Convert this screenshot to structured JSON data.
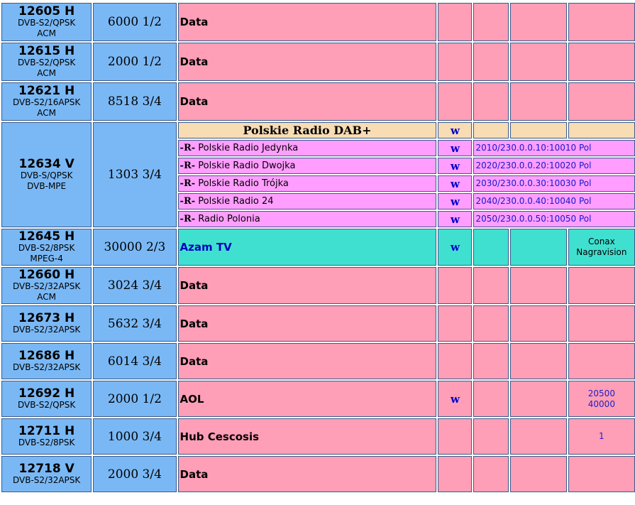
{
  "transponders": [
    {
      "freq": "12605 H",
      "sys": "DVB-S2/QPSK",
      "mod": "ACM",
      "sr": "6000 1/2",
      "name": "Data"
    },
    {
      "freq": "12615 H",
      "sys": "DVB-S2/QPSK",
      "mod": "ACM",
      "sr": "2000 1/2",
      "name": "Data"
    },
    {
      "freq": "12621 H",
      "sys": "DVB-S2/16APSK",
      "mod": "ACM",
      "sr": "8518 3/4",
      "name": "Data"
    },
    {
      "freq": "12634 V",
      "sys": "DVB-S/QPSK",
      "mod": "DVB-MPE",
      "sr": "1303 3/4",
      "package": "Polskie Radio DAB+",
      "package_w": "w",
      "radios": [
        {
          "mark": "-R-",
          "name": "Polskie Radio Jedynka",
          "w": "w",
          "pid": "2010/230.0.0.10:10010 Pol"
        },
        {
          "mark": "-R-",
          "name": "Polskie Radio Dwojka",
          "w": "w",
          "pid": "2020/230.0.0.20:10020 Pol"
        },
        {
          "mark": "-R-",
          "name": "Polskie Radio Trójka",
          "w": "w",
          "pid": "2030/230.0.0.30:10030 Pol"
        },
        {
          "mark": "-R-",
          "name": "Polskie Radio 24",
          "w": "w",
          "pid": "2040/230.0.0.40:10040 Pol"
        },
        {
          "mark": "-R-",
          "name": "Radio Polonia",
          "w": "w",
          "pid": "2050/230.0.0.50:10050 Pol"
        }
      ]
    },
    {
      "freq": "12645 H",
      "sys": "DVB-S2/8PSK",
      "mod": "MPEG-4",
      "sr": "30000 2/3",
      "name": "Azam TV",
      "w": "w",
      "ca1": "Conax",
      "ca2": "Nagravision"
    },
    {
      "freq": "12660 H",
      "sys": "DVB-S2/32APSK",
      "mod": "ACM",
      "sr": "3024 3/4",
      "name": "Data"
    },
    {
      "freq": "12673 H",
      "sys": "DVB-S2/32APSK",
      "sr": "5632 3/4",
      "name": "Data"
    },
    {
      "freq": "12686 H",
      "sys": "DVB-S2/32APSK",
      "sr": "6014 3/4",
      "name": "Data"
    },
    {
      "freq": "12692 H",
      "sys": "DVB-S2/QPSK",
      "sr": "2000 1/2",
      "name": "AOL",
      "w": "w",
      "num1": "20500",
      "num2": "40000"
    },
    {
      "freq": "12711 H",
      "sys": "DVB-S2/8PSK",
      "sr": "1000 3/4",
      "name": "Hub Cescosis",
      "num1": "1"
    },
    {
      "freq": "12718 V",
      "sys": "DVB-S2/32APSK",
      "sr": "2000 3/4",
      "name": "Data"
    }
  ]
}
